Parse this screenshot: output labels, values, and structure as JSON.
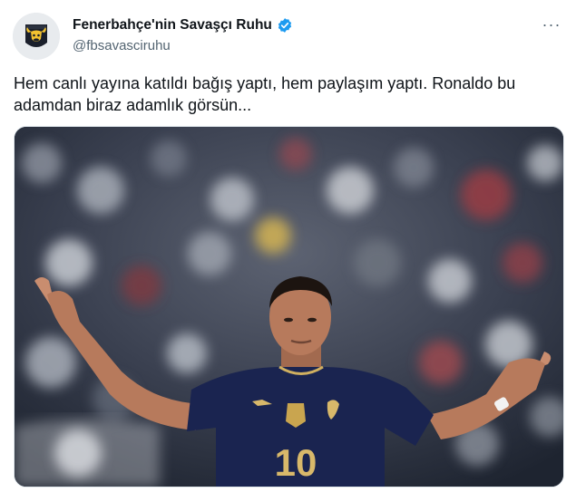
{
  "tweet": {
    "display_name": "Fenerbahçe'nin Savaşçı Ruhu",
    "handle": "@fbsavasciruhu",
    "text": "Hem canlı yayına katıldı bağış yaptı, hem paylaşım yaptı. Ronaldo bu adamdan biraz adamlık görsün...",
    "more_label": "···",
    "jersey_number": "10",
    "avatar_icon": "bull-logo-icon",
    "verified_icon": "verified-badge-icon",
    "verified_color": "#1d9bf0",
    "jersey_color": "#1a2450",
    "number_color": "#d8b86a"
  }
}
